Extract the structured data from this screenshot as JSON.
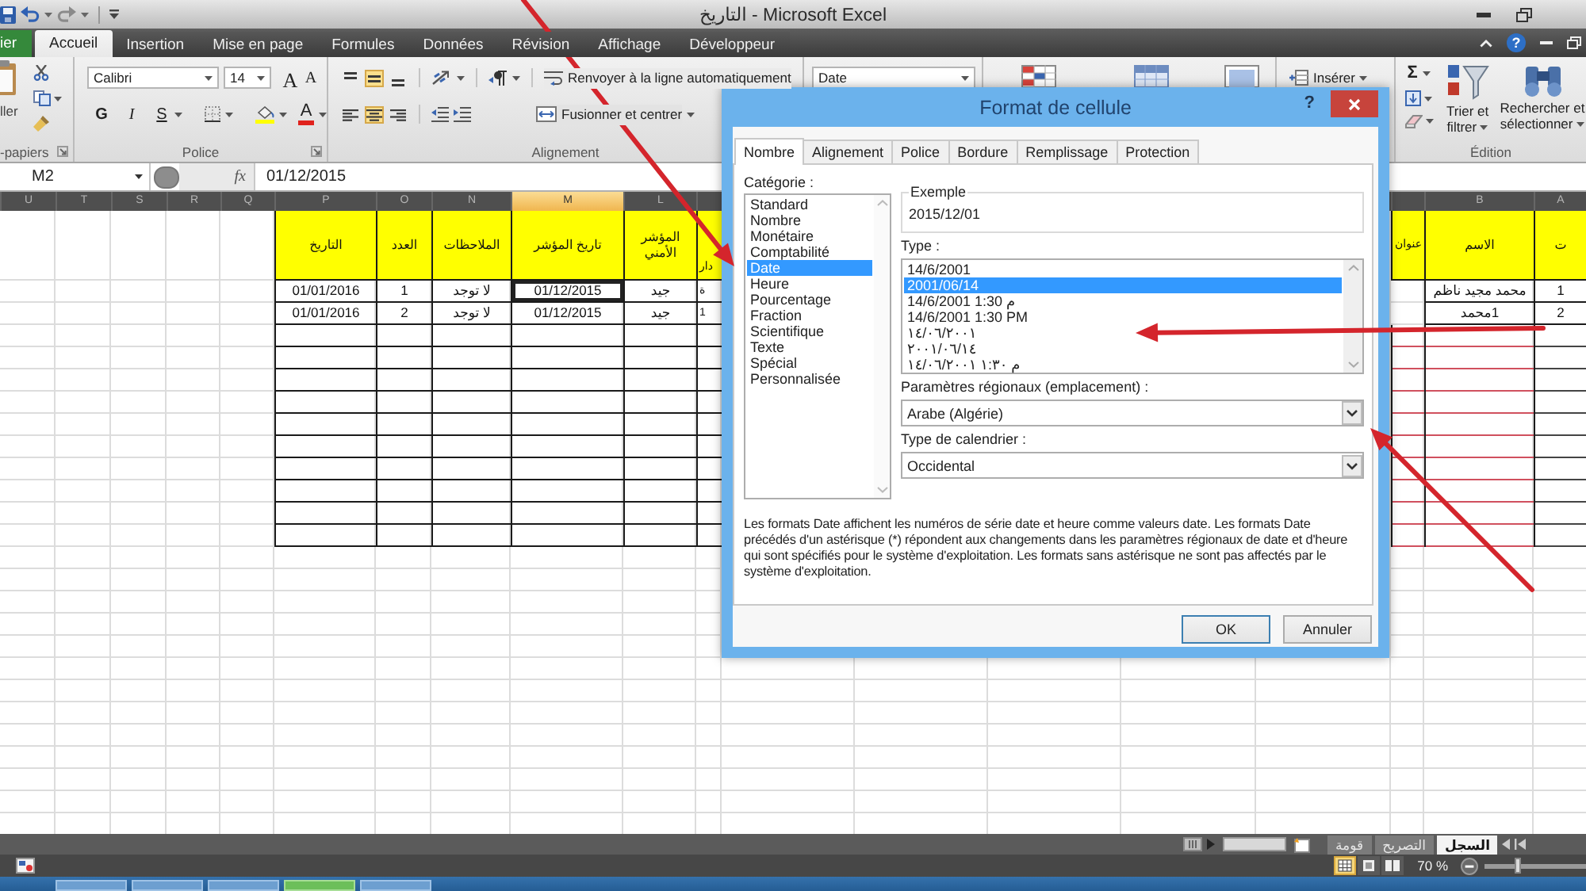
{
  "window": {
    "title": "التاريخ - Microsoft Excel",
    "help": "?"
  },
  "ribbon_tabs": [
    {
      "label": "ier",
      "kind": "file",
      "selected": false
    },
    {
      "label": "Accueil",
      "kind": "tab",
      "selected": true
    },
    {
      "label": "Insertion",
      "kind": "tab",
      "selected": false
    },
    {
      "label": "Mise en page",
      "kind": "tab",
      "selected": false
    },
    {
      "label": "Formules",
      "kind": "tab",
      "selected": false
    },
    {
      "label": "Données",
      "kind": "tab",
      "selected": false
    },
    {
      "label": "Révision",
      "kind": "tab",
      "selected": false
    },
    {
      "label": "Affichage",
      "kind": "tab",
      "selected": false
    },
    {
      "label": "Développeur",
      "kind": "tab",
      "selected": false
    }
  ],
  "ribbon": {
    "clipboard": {
      "paste": "ller",
      "label": "-papiers"
    },
    "font": {
      "name": "Calibri",
      "size": "14",
      "grow": "A",
      "shrink": "A",
      "bold": "G",
      "italic": "I",
      "underline": "S",
      "font_tint": "A",
      "label": "Police"
    },
    "alignment": {
      "vertical": [
        {
          "kind": "top",
          "selected": false
        },
        {
          "kind": "middle",
          "selected": true
        },
        {
          "kind": "bottom",
          "selected": false
        }
      ],
      "horizontal": [
        {
          "kind": "left",
          "selected": false
        },
        {
          "kind": "center",
          "selected": true
        },
        {
          "kind": "right",
          "selected": false
        }
      ],
      "wrap": "Renvoyer à la ligne automatiquement",
      "merge": "Fusionner et centrer",
      "label": "Alignement"
    },
    "number": {
      "format": "Date"
    },
    "cells": {
      "insert": "Insérer"
    },
    "editing": {
      "sum": "Σ",
      "sort": "Trier et filtrer",
      "find": "Rechercher et sélectionner",
      "label": "Édition"
    }
  },
  "formula_bar": {
    "name_box": "M2",
    "function_button": "fx",
    "formula": "01/12/2015"
  },
  "sheet": {
    "left_columns": [
      {
        "letter": "U",
        "selected": false
      },
      {
        "letter": "T",
        "selected": false
      },
      {
        "letter": "S",
        "selected": false
      },
      {
        "letter": "R",
        "selected": false
      },
      {
        "letter": "Q",
        "selected": false
      },
      {
        "letter": "P",
        "selected": false
      },
      {
        "letter": "O",
        "selected": false
      },
      {
        "letter": "N",
        "selected": false
      },
      {
        "letter": "M",
        "selected": true
      },
      {
        "letter": "L",
        "selected": false
      },
      {
        "selected": false
      }
    ],
    "right_columns": [
      {
        "selected": false
      },
      {
        "letter": "B",
        "selected": false
      },
      {
        "letter": "A",
        "selected": false
      }
    ],
    "right_headers": [
      "ت",
      "الاسم",
      "عنوان"
    ],
    "left_headers": [
      "دار",
      "المؤشر الأمني",
      "تاريخ المؤشر",
      "الملاحظات",
      "العدد",
      "التاريخ"
    ],
    "rows": [
      {
        "selected": true,
        "number": "1",
        "name": "محمد مجيد ناظم",
        "partial_column": "ة",
        "security_indicator": "جيد",
        "indicator_date": "01/12/2015",
        "notes": "لا توجد",
        "count": "1",
        "date": "01/01/2016"
      },
      {
        "selected": false,
        "number": "2",
        "name": "1محمد",
        "partial_column": "1",
        "security_indicator": "جيد",
        "indicator_date": "01/12/2015",
        "notes": "لا توجد",
        "count": "2",
        "date": "01/01/2016"
      }
    ]
  },
  "sheet_tabs": [
    {
      "label": "السجل",
      "selected": true
    },
    {
      "label": "التصريح",
      "selected": false
    },
    {
      "label": "قومة",
      "selected": false
    }
  ],
  "status_bar": {
    "views": [
      {
        "kind": "normal",
        "selected": true
      },
      {
        "kind": "page_layout",
        "selected": false
      },
      {
        "kind": "page_break",
        "selected": false
      }
    ],
    "zoom": "70 %",
    "zoom_slider": {
      "level": 0.33
    }
  },
  "dialog": {
    "title": "Format de cellule",
    "help": "?",
    "tabs": [
      {
        "label": "Nombre",
        "selected": true
      },
      {
        "label": "Alignement",
        "selected": false
      },
      {
        "label": "Police",
        "selected": false
      },
      {
        "label": "Bordure",
        "selected": false
      },
      {
        "label": "Remplissage",
        "selected": false
      },
      {
        "label": "Protection",
        "selected": false
      }
    ],
    "category_label": "Catégorie :",
    "categories": [
      {
        "label": "Standard",
        "selected": false
      },
      {
        "label": "Nombre",
        "selected": false
      },
      {
        "label": "Monétaire",
        "selected": false
      },
      {
        "label": "Comptabilité",
        "selected": false
      },
      {
        "label": "Date",
        "selected": true
      },
      {
        "label": "Heure",
        "selected": false
      },
      {
        "label": "Pourcentage",
        "selected": false
      },
      {
        "label": "Fraction",
        "selected": false
      },
      {
        "label": "Scientifique",
        "selected": false
      },
      {
        "label": "Texte",
        "selected": false
      },
      {
        "label": "Spécial",
        "selected": false
      },
      {
        "label": "Personnalisée",
        "selected": false
      }
    ],
    "sample_label": "Exemple",
    "sample": "2015/12/01",
    "type_label": "Type :",
    "types": [
      {
        "label": "14/6/2001",
        "selected": false
      },
      {
        "label": "2001/06/14",
        "selected": true
      },
      {
        "label": "14/6/2001 1:30 م",
        "selected": false
      },
      {
        "label": "14/6/2001 1:30 PM",
        "selected": false
      },
      {
        "label": "١٤/٠٦/٢٠٠١",
        "selected": false
      },
      {
        "label": "٢٠٠١/٠٦/١٤",
        "selected": false
      },
      {
        "label": "١٤/٠٦/٢٠٠١ ١:٣٠ م",
        "selected": false
      }
    ],
    "locale_label": "Paramètres régionaux (emplacement) :",
    "locale": "Arabe (Algérie)",
    "calendar_label": "Type de calendrier :",
    "calendar": "Occidental",
    "description": "Les formats Date affichent les numéros de série date et heure comme valeurs date. Les formats Date précédés d'un astérisque (*) répondent aux changements dans les paramètres régionaux de date et d'heure qui sont spécifiés pour le système d'exploitation. Les formats sans astérisque ne sont pas affectés par le système d'exploitation.",
    "buttons": [
      {
        "label": "OK",
        "kind": "confirm"
      },
      {
        "label": "Annuler",
        "kind": "cancel"
      }
    ]
  }
}
